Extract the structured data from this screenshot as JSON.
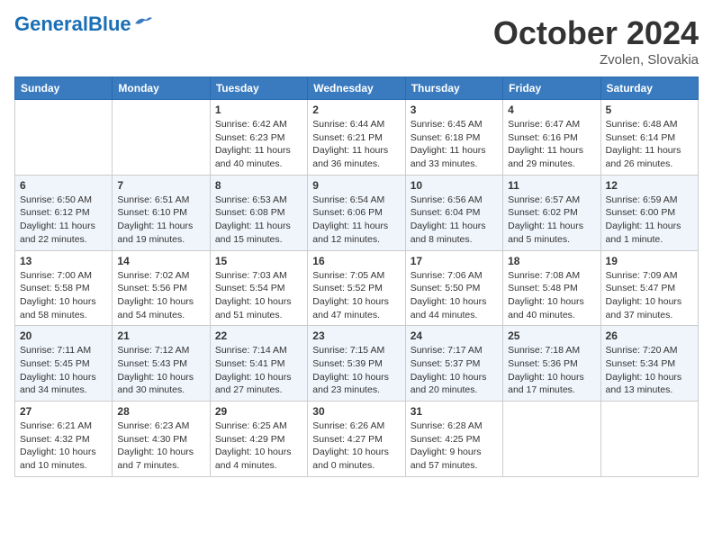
{
  "header": {
    "logo_general": "General",
    "logo_blue": "Blue",
    "month_title": "October 2024",
    "location": "Zvolen, Slovakia"
  },
  "calendar": {
    "days_of_week": [
      "Sunday",
      "Monday",
      "Tuesday",
      "Wednesday",
      "Thursday",
      "Friday",
      "Saturday"
    ],
    "weeks": [
      [
        {
          "day": "",
          "info": ""
        },
        {
          "day": "",
          "info": ""
        },
        {
          "day": "1",
          "info": "Sunrise: 6:42 AM\nSunset: 6:23 PM\nDaylight: 11 hours and 40 minutes."
        },
        {
          "day": "2",
          "info": "Sunrise: 6:44 AM\nSunset: 6:21 PM\nDaylight: 11 hours and 36 minutes."
        },
        {
          "day": "3",
          "info": "Sunrise: 6:45 AM\nSunset: 6:18 PM\nDaylight: 11 hours and 33 minutes."
        },
        {
          "day": "4",
          "info": "Sunrise: 6:47 AM\nSunset: 6:16 PM\nDaylight: 11 hours and 29 minutes."
        },
        {
          "day": "5",
          "info": "Sunrise: 6:48 AM\nSunset: 6:14 PM\nDaylight: 11 hours and 26 minutes."
        }
      ],
      [
        {
          "day": "6",
          "info": "Sunrise: 6:50 AM\nSunset: 6:12 PM\nDaylight: 11 hours and 22 minutes."
        },
        {
          "day": "7",
          "info": "Sunrise: 6:51 AM\nSunset: 6:10 PM\nDaylight: 11 hours and 19 minutes."
        },
        {
          "day": "8",
          "info": "Sunrise: 6:53 AM\nSunset: 6:08 PM\nDaylight: 11 hours and 15 minutes."
        },
        {
          "day": "9",
          "info": "Sunrise: 6:54 AM\nSunset: 6:06 PM\nDaylight: 11 hours and 12 minutes."
        },
        {
          "day": "10",
          "info": "Sunrise: 6:56 AM\nSunset: 6:04 PM\nDaylight: 11 hours and 8 minutes."
        },
        {
          "day": "11",
          "info": "Sunrise: 6:57 AM\nSunset: 6:02 PM\nDaylight: 11 hours and 5 minutes."
        },
        {
          "day": "12",
          "info": "Sunrise: 6:59 AM\nSunset: 6:00 PM\nDaylight: 11 hours and 1 minute."
        }
      ],
      [
        {
          "day": "13",
          "info": "Sunrise: 7:00 AM\nSunset: 5:58 PM\nDaylight: 10 hours and 58 minutes."
        },
        {
          "day": "14",
          "info": "Sunrise: 7:02 AM\nSunset: 5:56 PM\nDaylight: 10 hours and 54 minutes."
        },
        {
          "day": "15",
          "info": "Sunrise: 7:03 AM\nSunset: 5:54 PM\nDaylight: 10 hours and 51 minutes."
        },
        {
          "day": "16",
          "info": "Sunrise: 7:05 AM\nSunset: 5:52 PM\nDaylight: 10 hours and 47 minutes."
        },
        {
          "day": "17",
          "info": "Sunrise: 7:06 AM\nSunset: 5:50 PM\nDaylight: 10 hours and 44 minutes."
        },
        {
          "day": "18",
          "info": "Sunrise: 7:08 AM\nSunset: 5:48 PM\nDaylight: 10 hours and 40 minutes."
        },
        {
          "day": "19",
          "info": "Sunrise: 7:09 AM\nSunset: 5:47 PM\nDaylight: 10 hours and 37 minutes."
        }
      ],
      [
        {
          "day": "20",
          "info": "Sunrise: 7:11 AM\nSunset: 5:45 PM\nDaylight: 10 hours and 34 minutes."
        },
        {
          "day": "21",
          "info": "Sunrise: 7:12 AM\nSunset: 5:43 PM\nDaylight: 10 hours and 30 minutes."
        },
        {
          "day": "22",
          "info": "Sunrise: 7:14 AM\nSunset: 5:41 PM\nDaylight: 10 hours and 27 minutes."
        },
        {
          "day": "23",
          "info": "Sunrise: 7:15 AM\nSunset: 5:39 PM\nDaylight: 10 hours and 23 minutes."
        },
        {
          "day": "24",
          "info": "Sunrise: 7:17 AM\nSunset: 5:37 PM\nDaylight: 10 hours and 20 minutes."
        },
        {
          "day": "25",
          "info": "Sunrise: 7:18 AM\nSunset: 5:36 PM\nDaylight: 10 hours and 17 minutes."
        },
        {
          "day": "26",
          "info": "Sunrise: 7:20 AM\nSunset: 5:34 PM\nDaylight: 10 hours and 13 minutes."
        }
      ],
      [
        {
          "day": "27",
          "info": "Sunrise: 6:21 AM\nSunset: 4:32 PM\nDaylight: 10 hours and 10 minutes."
        },
        {
          "day": "28",
          "info": "Sunrise: 6:23 AM\nSunset: 4:30 PM\nDaylight: 10 hours and 7 minutes."
        },
        {
          "day": "29",
          "info": "Sunrise: 6:25 AM\nSunset: 4:29 PM\nDaylight: 10 hours and 4 minutes."
        },
        {
          "day": "30",
          "info": "Sunrise: 6:26 AM\nSunset: 4:27 PM\nDaylight: 10 hours and 0 minutes."
        },
        {
          "day": "31",
          "info": "Sunrise: 6:28 AM\nSunset: 4:25 PM\nDaylight: 9 hours and 57 minutes."
        },
        {
          "day": "",
          "info": ""
        },
        {
          "day": "",
          "info": ""
        }
      ]
    ]
  }
}
